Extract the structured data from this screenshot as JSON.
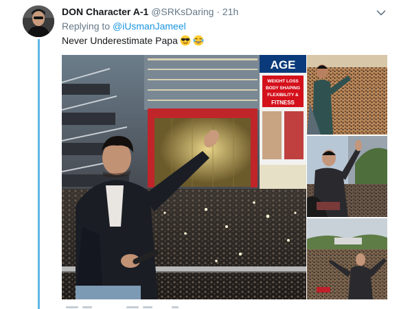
{
  "tweet": {
    "author_name": "DON Character A-1",
    "author_handle": "@SRKsDaring",
    "separator": "·",
    "timestamp": "21h",
    "reply_prefix": "Replying to",
    "reply_to_handle": "@iUsmanJameel",
    "text": "Never Underestimate Papa",
    "emojis": [
      "sunglasses-emoji",
      "laughing-tears-emoji"
    ],
    "media_count": 4
  },
  "icons": {
    "menu": "chevron-down-icon",
    "thread": "thread-connector-line"
  },
  "colors": {
    "name": "#14171a",
    "muted": "#657786",
    "link": "#1b95e0",
    "thread_line": "#5fb6e6",
    "sign_banner": "#0a3a7a",
    "sign_accent": "#d4101b"
  },
  "sign": {
    "title": "AGE",
    "lines": [
      "WEIGHT LOSS",
      "BODY SHAPING",
      "FLEXIBILITY &",
      "FITNESS"
    ]
  }
}
